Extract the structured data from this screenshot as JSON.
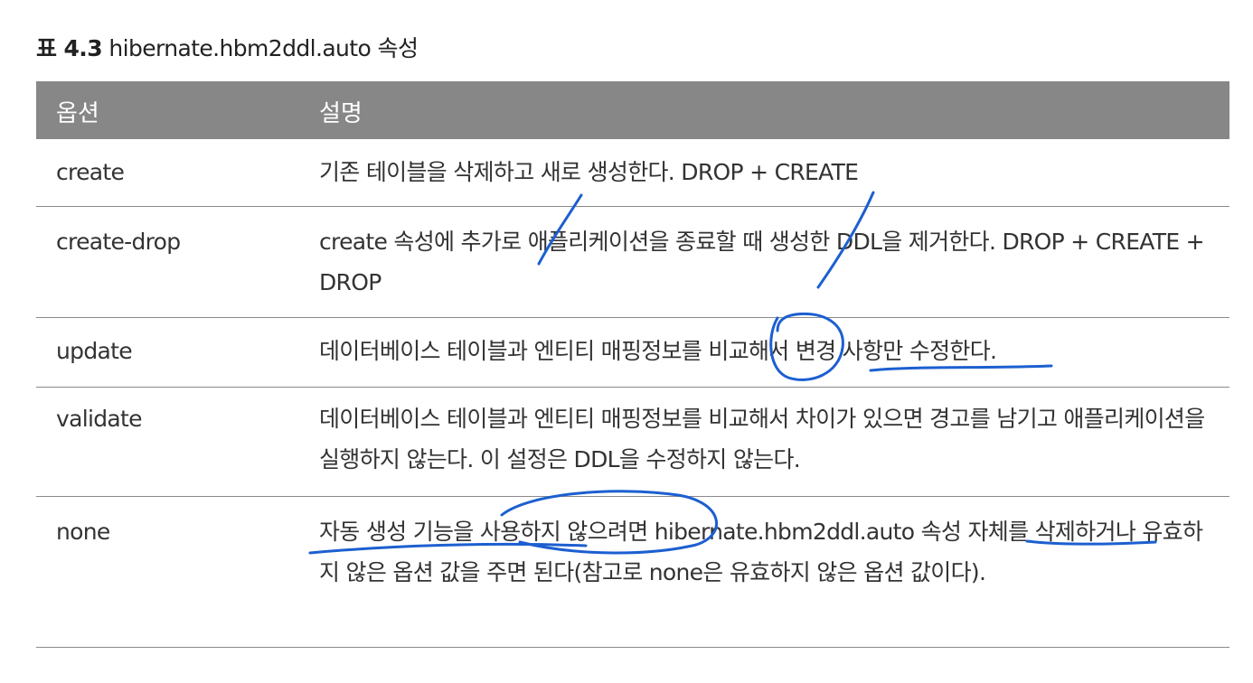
{
  "caption": {
    "number": "표 4.3",
    "title": "hibernate.hbm2ddl.auto 속성"
  },
  "table": {
    "headers": [
      "옵션",
      "설명"
    ],
    "rows": [
      {
        "option": "create",
        "description": "기존 테이블을 삭제하고 새로 생성한다. DROP + CREATE"
      },
      {
        "option": "create-drop",
        "description": "create 속성에 추가로 애플리케이션을 종료할 때 생성한 DDL을 제거한다. DROP + CREATE + DROP"
      },
      {
        "option": "update",
        "description": "데이터베이스 테이블과 엔티티 매핑정보를 비교해서 변경 사항만 수정한다."
      },
      {
        "option": "validate",
        "description": "데이터베이스 테이블과 엔티티 매핑정보를 비교해서 차이가 있으면 경고를 남기고 애플리케이션을 실행하지 않는다. 이 설정은 DDL을 수정하지 않는다."
      },
      {
        "option": "none",
        "description": "자동 생성 기능을 사용하지 않으려면 hibernate.hbm2ddl.auto 속성 자체를 삭제하거나 유효하지 않은 옵션 값을 주면 된다(참고로 none은 유효하지 않은 옵션 값이다)."
      }
    ]
  },
  "annotation": {
    "ink_color": "#1c5fd0"
  }
}
